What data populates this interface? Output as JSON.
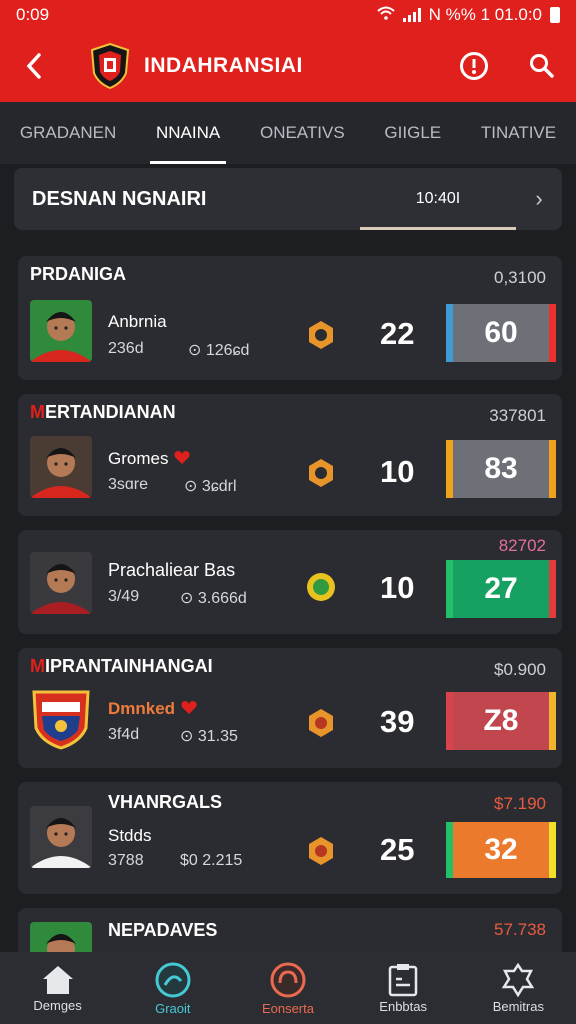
{
  "status": {
    "time": "0:09",
    "right": "N  %%  1 01.0:0"
  },
  "appbar": {
    "back_icon": "‹",
    "title": "INDAHRANSIAI"
  },
  "tabs": [
    {
      "label": "GRADANEN",
      "active": false
    },
    {
      "label": "NNAINA",
      "active": true
    },
    {
      "label": "ONEATIVS",
      "active": false
    },
    {
      "label": "GIIGLE",
      "active": false
    },
    {
      "label": "TINATIVE",
      "active": false
    }
  ],
  "header": {
    "title": "DESNAN NGNAIRI",
    "time": "10:40I",
    "chevron": "›"
  },
  "cards": [
    {
      "title_first": "P",
      "title_rest": "RDANIGA",
      "stat": "0,3100",
      "stat_color": "#cfd0d5",
      "name": "Anbrnia",
      "num": "236d",
      "meta": "⊙ 126ɕd",
      "score": "22",
      "rating": "60",
      "rating_bg": "#6d7077",
      "left_color": "#3f9bd5",
      "right_color": "#ec2f2f"
    },
    {
      "title_first": "M",
      "title_rest": "ERTANDIANAN",
      "stat": "337801",
      "stat_color": "#cfd0d5",
      "name": "Gromes",
      "num": "3sɑre",
      "meta": "⊙ 3ɕdrl",
      "score": "10",
      "rating": "83",
      "rating_bg": "#6d7077",
      "left_color": "#f0a21b",
      "right_color": "#f0a21b"
    },
    {
      "title_first": "",
      "title_rest": "",
      "stat": "82702",
      "stat_color": "#e0709a",
      "name": "Prachaliear Bas",
      "num": "3/49",
      "meta": "⊙ 3.666d",
      "score": "10",
      "rating": "27",
      "rating_bg": "#16a162",
      "left_color": "#22c06a",
      "right_color": "#e33b3b"
    },
    {
      "title_first": "M",
      "title_rest": "IPRANTAINHANGAI",
      "stat": "$0.900",
      "stat_color": "#cfd0d5",
      "name": "Dmnked",
      "num": "3f4d",
      "meta": "⊙ 31.35",
      "score": "39",
      "rating": "Z8",
      "rating_bg": "#c2464e",
      "left_color": "#d9434b",
      "right_color": "#f0b52a"
    },
    {
      "title_first": "",
      "title_rest": "VHANRGALS",
      "stat": "$7.190",
      "stat_color": "#ea5a3f",
      "name": "Stdds",
      "num": "3788",
      "meta": "$0 2.215",
      "score": "25",
      "rating": "32",
      "rating_bg": "#ec7a2c",
      "left_color": "#22c06a",
      "right_color": "#f0e02b"
    },
    {
      "title_first": "",
      "title_rest": "NEPADAVES",
      "stat": "57.738",
      "stat_color": "#ea5a3f"
    }
  ],
  "bottom_nav": [
    {
      "label": "Demges",
      "icon": "home-icon"
    },
    {
      "label": "Graoit",
      "icon": "chart-circle-icon"
    },
    {
      "label": "Eonserta",
      "icon": "headset-icon"
    },
    {
      "label": "Enbbtas",
      "icon": "clipboard-icon"
    },
    {
      "label": "Bemitras",
      "icon": "shield-badge-icon"
    }
  ],
  "colors": {
    "brand_red": "#e0201c",
    "background": "#1d1e22",
    "card": "#2b2c31",
    "nav_active": "#45c9d4"
  }
}
